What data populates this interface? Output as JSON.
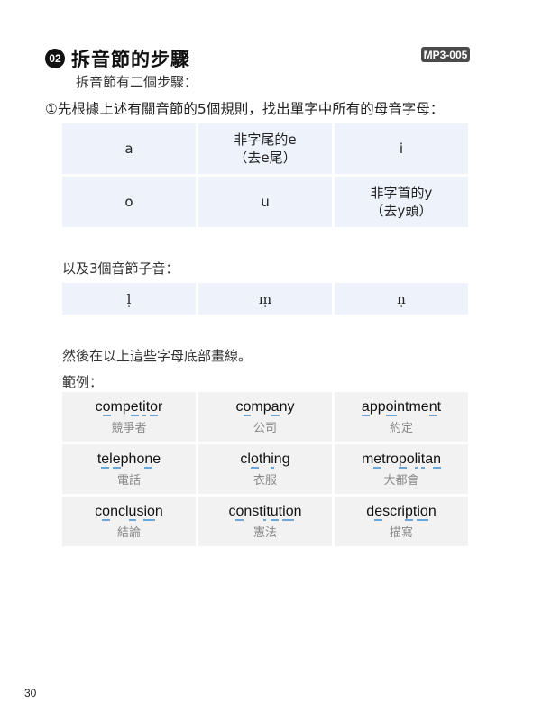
{
  "header": {
    "number": "02",
    "title": "拆音節的步驟",
    "audio_track": "MP3-005"
  },
  "intro": "拆音節有二個步驟：",
  "step1": "①先根據上述有關音節的5個規則，找出單字中所有的母音字母：",
  "vowels": [
    {
      "line1": "a",
      "line2": ""
    },
    {
      "line1": "非字尾的e",
      "line2": "（去e尾）"
    },
    {
      "line1": "i",
      "line2": ""
    },
    {
      "line1": "o",
      "line2": ""
    },
    {
      "line1": "u",
      "line2": ""
    },
    {
      "line1": "非字首的y",
      "line2": "（去y頭）"
    }
  ],
  "consonants_label": "以及3個音節子音：",
  "consonants": [
    "l̩",
    "m̩",
    "n̩"
  ],
  "then_text": "然後在以上這些字母底部畫線。",
  "example_label": "範例：",
  "underline_color": "#6aa6d8",
  "examples": [
    {
      "word": "competitor",
      "underlined": [
        1,
        4,
        6,
        8
      ],
      "gloss": "競爭者"
    },
    {
      "word": "company",
      "underlined": [
        1,
        4
      ],
      "gloss": "公司"
    },
    {
      "word": "appointment",
      "underlined": [
        0,
        3,
        4,
        9
      ],
      "gloss": "約定"
    },
    {
      "word": "telephone",
      "underlined": [
        1,
        3,
        7
      ],
      "gloss": "電話"
    },
    {
      "word": "clothing",
      "underlined": [
        2,
        5
      ],
      "gloss": "衣服"
    },
    {
      "word": "metropolitan",
      "underlined": [
        1,
        5,
        7,
        9,
        11
      ],
      "gloss": "大都會"
    },
    {
      "word": "conclusion",
      "underlined": [
        1,
        5,
        7,
        8
      ],
      "gloss": "結論"
    },
    {
      "word": "constitution",
      "underlined": [
        1,
        5,
        7,
        9,
        10
      ],
      "gloss": "憲法"
    },
    {
      "word": "description",
      "underlined": [
        1,
        6,
        8,
        9
      ],
      "gloss": "描寫"
    }
  ],
  "page_number": "30"
}
